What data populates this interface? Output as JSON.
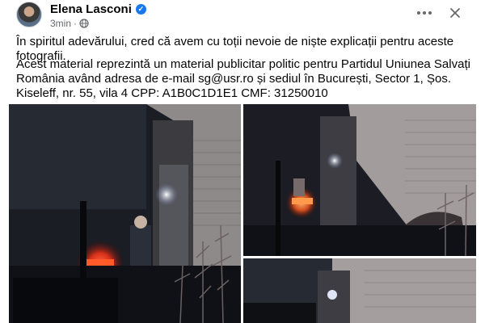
{
  "post": {
    "author": "Elena Lasconi",
    "timestamp": "3min",
    "separator": "·",
    "paragraph_1": "În spiritul adevărului, cred că avem cu toții nevoie de niște explicații pentru aceste fotografii.",
    "paragraph_2": "Acest material reprezintă un material publicitar politic pentru Partidul Uniunea Salvați România având adresa de e-mail sg@usr.ro și sediul în București, Sector 1, Șos. Kiseleff, nr. 55, vila 4 CPP: A1B0C1D1E1 CMF: 31250010"
  },
  "icons": {
    "verified": "verified-badge-icon",
    "audience": "globe-icon",
    "more": "more-options-icon",
    "close": "close-icon"
  },
  "colors": {
    "accent": "#1877f2",
    "text": "#050505",
    "muted": "#65676b"
  },
  "photos": [
    {
      "name": "night-photo-1"
    },
    {
      "name": "night-photo-2"
    },
    {
      "name": "night-photo-3"
    }
  ]
}
